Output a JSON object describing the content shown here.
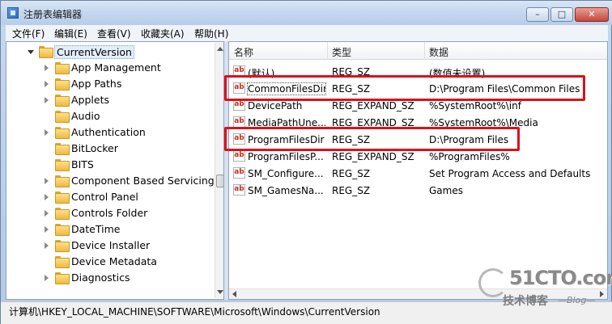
{
  "window": {
    "title": "注册表编辑器"
  },
  "controls": {
    "minimize": "–",
    "maximize": "□",
    "close": "✕"
  },
  "menu": [
    "文件(F)",
    "编辑(E)",
    "查看(V)",
    "收藏夹(A)",
    "帮助(H)"
  ],
  "tree": {
    "selected": "CurrentVersion",
    "children": [
      "App Management",
      "App Paths",
      "Applets",
      "Audio",
      "Authentication",
      "BitLocker",
      "BITS",
      "Component Based Servicing",
      "Control Panel",
      "Controls Folder",
      "DateTime",
      "Device Installer",
      "Device Metadata",
      "Diagnostics"
    ]
  },
  "list": {
    "columns": {
      "name": "名称",
      "type": "类型",
      "data": "数据"
    },
    "icon_text": "ab",
    "rows": [
      {
        "name": "(默认)",
        "type": "REG_SZ",
        "data": "(数值未设置)"
      },
      {
        "name": "CommonFilesDir",
        "type": "REG_SZ",
        "data": "D:\\Program Files\\Common Files"
      },
      {
        "name": "DevicePath",
        "type": "REG_EXPAND_SZ",
        "data": "%SystemRoot%\\inf"
      },
      {
        "name": "MediaPathUne...",
        "type": "REG_EXPAND_SZ",
        "data": "%SystemRoot%\\Media"
      },
      {
        "name": "ProgramFilesDir",
        "type": "REG_SZ",
        "data": "D:\\Program Files"
      },
      {
        "name": "ProgramFilesP...",
        "type": "REG_EXPAND_SZ",
        "data": "%ProgramFiles%"
      },
      {
        "name": "SM_Configure...",
        "type": "REG_SZ",
        "data": "Set Program Access and Defaults"
      },
      {
        "name": "SM_GamesNa...",
        "type": "REG_SZ",
        "data": "Games"
      }
    ]
  },
  "status": {
    "path": "计算机\\HKEY_LOCAL_MACHINE\\SOFTWARE\\Microsoft\\Windows\\CurrentVersion"
  },
  "watermark": {
    "main": "51CTO.com",
    "sub": "技术博客",
    "blog": "—Blog—"
  },
  "colors": {
    "highlight": "#d9121c",
    "title_bg": "#c4d7ee",
    "close_button": "#c7463a"
  }
}
